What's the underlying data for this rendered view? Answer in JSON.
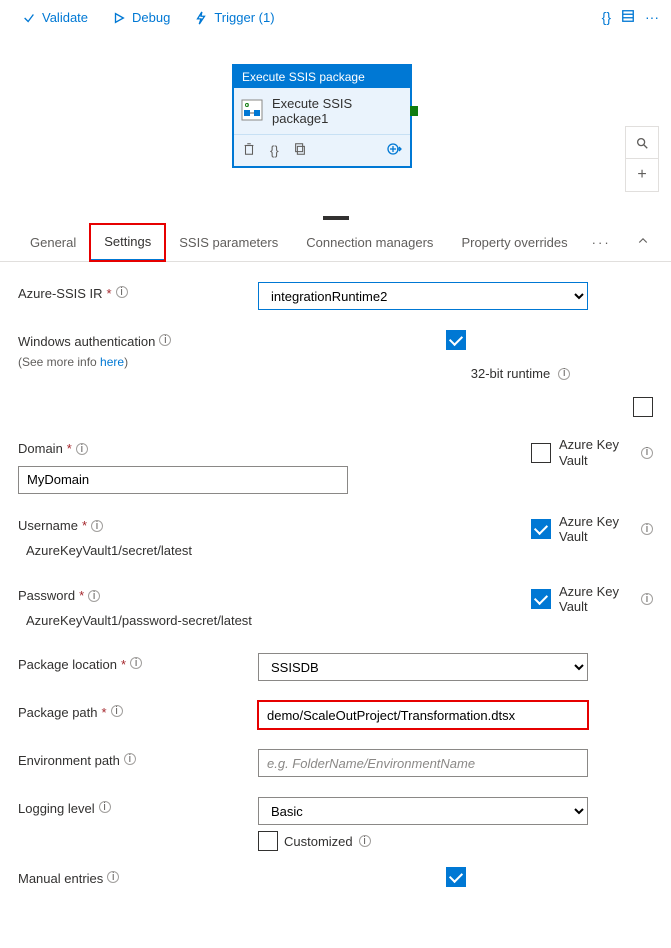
{
  "toolbar": {
    "validate": "Validate",
    "debug": "Debug",
    "trigger": "Trigger (1)"
  },
  "node": {
    "title": "Execute SSIS package",
    "label": "Execute SSIS package1"
  },
  "tabs": {
    "general": "General",
    "settings": "Settings",
    "ssis_parameters": "SSIS parameters",
    "connection_managers": "Connection managers",
    "property_overrides": "Property overrides",
    "more": "···"
  },
  "form": {
    "azure_ssis_ir": {
      "label": "Azure-SSIS IR",
      "value": "integrationRuntime2"
    },
    "windows_auth": {
      "label": "Windows authentication",
      "sub_pre": "(See more info ",
      "sub_link": "here",
      "sub_post": ")",
      "checked": true
    },
    "runtime_32bit": {
      "label": "32-bit runtime",
      "checked": false
    },
    "domain": {
      "label": "Domain",
      "value": "MyDomain",
      "akv_label": "Azure Key Vault",
      "akv_checked": false
    },
    "username": {
      "label": "Username",
      "value": "AzureKeyVault1/secret/latest",
      "akv_label": "Azure Key Vault",
      "akv_checked": true
    },
    "password": {
      "label": "Password",
      "value": "AzureKeyVault1/password-secret/latest",
      "akv_label": "Azure Key Vault",
      "akv_checked": true
    },
    "package_location": {
      "label": "Package location",
      "value": "SSISDB"
    },
    "package_path": {
      "label": "Package path",
      "value": "demo/ScaleOutProject/Transformation.dtsx"
    },
    "environment_path": {
      "label": "Environment path",
      "placeholder": "e.g. FolderName/EnvironmentName"
    },
    "logging_level": {
      "label": "Logging level",
      "value": "Basic",
      "customized_label": "Customized",
      "customized_checked": false
    },
    "manual_entries": {
      "label": "Manual entries",
      "checked": true
    }
  }
}
